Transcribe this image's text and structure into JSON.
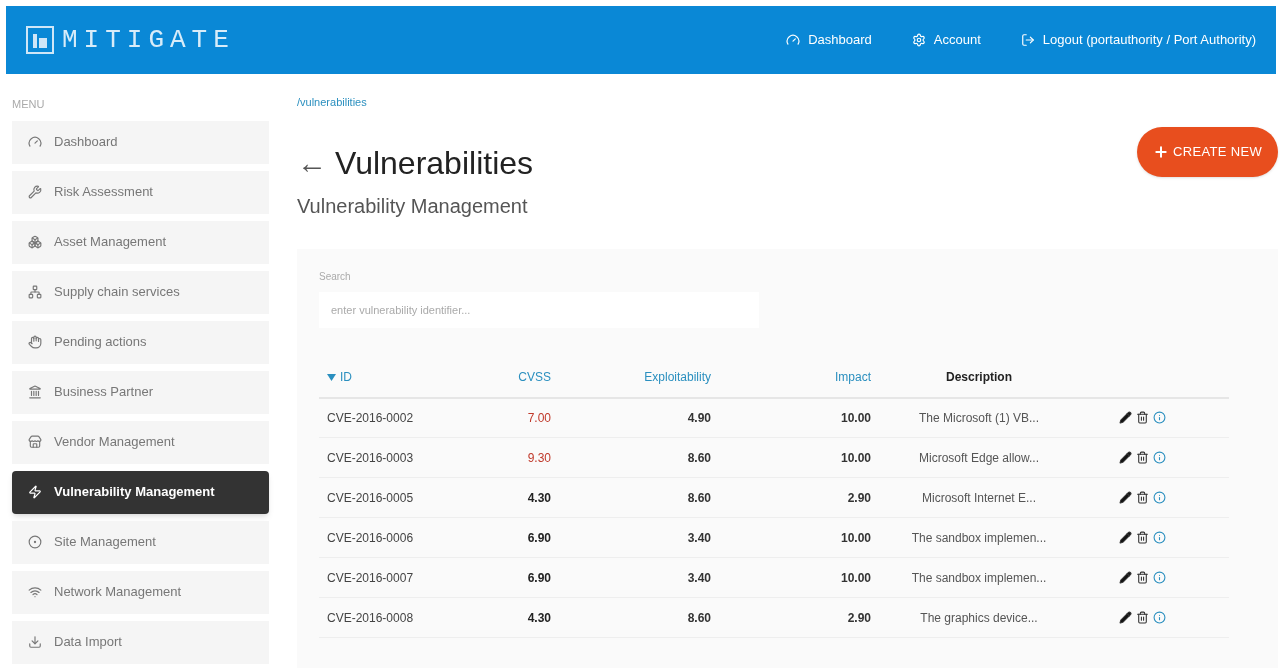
{
  "header": {
    "logo": "MITIGATE",
    "nav": [
      {
        "kind": "dashboard",
        "label": "Dashboard"
      },
      {
        "kind": "account",
        "label": "Account"
      },
      {
        "kind": "logout",
        "label": "Logout (portauthority / Port Authority)"
      }
    ]
  },
  "sidebar": {
    "title": "MENU",
    "items": [
      {
        "kind": "dashboard",
        "label": "Dashboard",
        "selected": false
      },
      {
        "kind": "risk",
        "label": "Risk Assessment",
        "selected": false
      },
      {
        "kind": "asset",
        "label": "Asset Management",
        "selected": false
      },
      {
        "kind": "supply",
        "label": "Supply chain services",
        "selected": false
      },
      {
        "kind": "pending",
        "label": "Pending actions",
        "selected": false
      },
      {
        "kind": "partner",
        "label": "Business Partner",
        "selected": false
      },
      {
        "kind": "vendor",
        "label": "Vendor Management",
        "selected": false
      },
      {
        "kind": "vuln",
        "label": "Vulnerability Management",
        "selected": true
      },
      {
        "kind": "site",
        "label": "Site Management",
        "selected": false
      },
      {
        "kind": "network",
        "label": "Network Management",
        "selected": false
      },
      {
        "kind": "import",
        "label": "Data Import",
        "selected": false
      }
    ]
  },
  "breadcrumb": "/vulnerabilities",
  "page": {
    "back": "←",
    "title": "Vulnerabilities",
    "subtitle": "Vulnerability Management",
    "create_button": "CREATE NEW"
  },
  "search": {
    "label": "Search",
    "placeholder": "enter vulnerability identifier..."
  },
  "table": {
    "columns": [
      {
        "label": "ID",
        "sorted": true
      },
      {
        "label": "CVSS",
        "sorted": false
      },
      {
        "label": "Exploitability",
        "sorted": false
      },
      {
        "label": "Impact",
        "sorted": false
      },
      {
        "label": "Description",
        "sorted": false
      }
    ],
    "rows": [
      {
        "id": "CVE-2016-0002",
        "cvss": "7.00",
        "high": true,
        "exploitability": "4.90",
        "impact": "10.00",
        "description": "The Microsoft (1) VB..."
      },
      {
        "id": "CVE-2016-0003",
        "cvss": "9.30",
        "high": true,
        "exploitability": "8.60",
        "impact": "10.00",
        "description": "Microsoft Edge allow..."
      },
      {
        "id": "CVE-2016-0005",
        "cvss": "4.30",
        "high": false,
        "exploitability": "8.60",
        "impact": "2.90",
        "description": "Microsoft Internet E..."
      },
      {
        "id": "CVE-2016-0006",
        "cvss": "6.90",
        "high": false,
        "exploitability": "3.40",
        "impact": "10.00",
        "description": "The sandbox implemen..."
      },
      {
        "id": "CVE-2016-0007",
        "cvss": "6.90",
        "high": false,
        "exploitability": "3.40",
        "impact": "10.00",
        "description": "The sandbox implemen..."
      },
      {
        "id": "CVE-2016-0008",
        "cvss": "4.30",
        "high": false,
        "exploitability": "8.60",
        "impact": "2.90",
        "description": "The graphics device..."
      }
    ]
  }
}
